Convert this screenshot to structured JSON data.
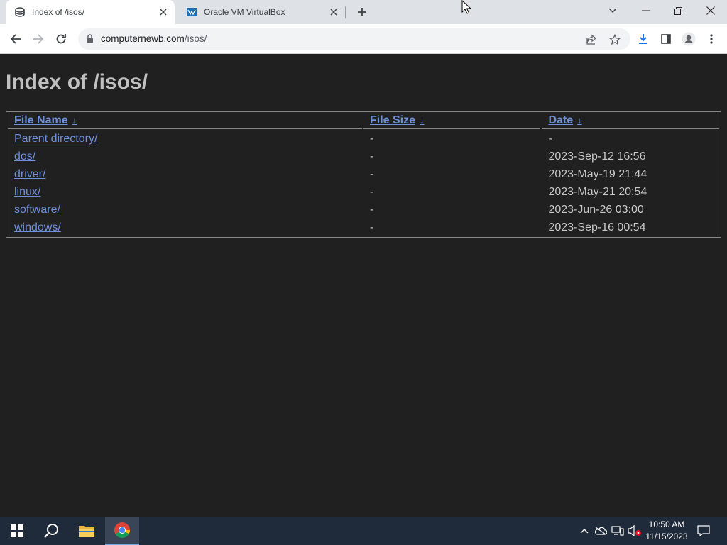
{
  "browser": {
    "tabs": [
      {
        "title": "Index of /isos/",
        "active": true,
        "icon": "server-globe-icon"
      },
      {
        "title": "Oracle VM VirtualBox",
        "active": false,
        "icon": "virtualbox-icon"
      }
    ],
    "address_bar": {
      "host": "computernewb.com",
      "path": "/isos/"
    }
  },
  "page": {
    "heading": "Index of /isos/",
    "columns": [
      {
        "label": "File Name",
        "sort_icon": "↓"
      },
      {
        "label": "File Size",
        "sort_icon": "↓"
      },
      {
        "label": "Date",
        "sort_icon": "↓"
      }
    ],
    "rows": [
      {
        "name": "Parent directory/",
        "size": "-",
        "date": "-"
      },
      {
        "name": "dos/",
        "size": "-",
        "date": "2023-Sep-12 16:56"
      },
      {
        "name": "driver/",
        "size": "-",
        "date": "2023-May-19 21:44"
      },
      {
        "name": "linux/",
        "size": "-",
        "date": "2023-May-21 20:54"
      },
      {
        "name": "software/",
        "size": "-",
        "date": "2023-Jun-26 03:00"
      },
      {
        "name": "windows/",
        "size": "-",
        "date": "2023-Sep-16 00:54"
      }
    ]
  },
  "taskbar": {
    "time": "10:50 AM",
    "date": "11/15/2023"
  },
  "colors": {
    "page_background": "#202020",
    "link": "#6f8fd8",
    "taskbar": "#1f2a3a"
  }
}
